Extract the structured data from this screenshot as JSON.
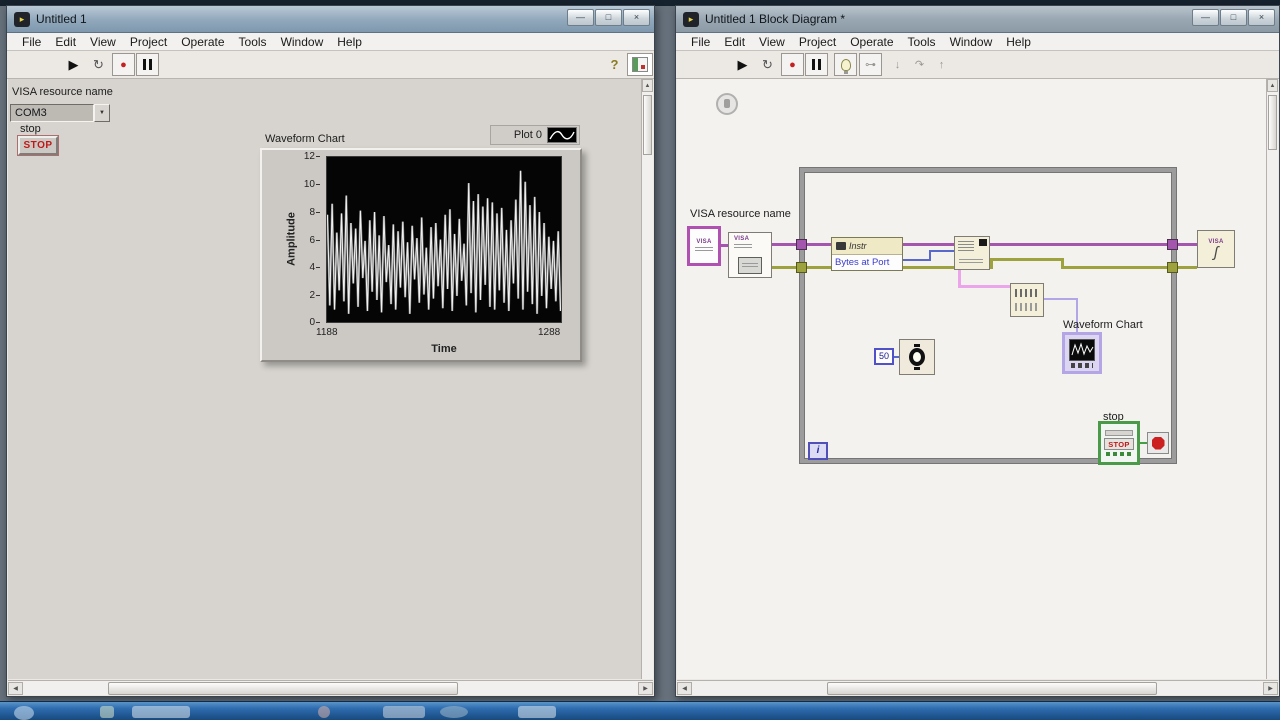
{
  "menus": [
    "File",
    "Edit",
    "View",
    "Project",
    "Operate",
    "Tools",
    "Window",
    "Help"
  ],
  "glyphs": {
    "lv_logo": "▸",
    "run": "▶",
    "run_continuous": "↻",
    "abort": "●",
    "help": "?",
    "dropdown": "▼",
    "scroll_left": "◀",
    "scroll_right": "▶",
    "scroll_up": "▲",
    "minimize": "—",
    "maximize": "□",
    "close": "×",
    "step_a": "↓",
    "step_b": "↷",
    "step_c": "↑",
    "retain": "⊶",
    "visa_close_glyph": "ʃ"
  },
  "front_panel": {
    "window_title": "Untitled 1",
    "visa_label": "VISA resource name",
    "visa_value": "COM3",
    "stop_label": "stop",
    "stop_button_text": "STOP",
    "chart": {
      "title": "Waveform Chart",
      "legend_label": "Plot 0",
      "y_axis_label": "Amplitude",
      "x_axis_label": "Time",
      "y_ticks": [
        "12",
        "10",
        "8",
        "6",
        "4",
        "2",
        "0"
      ],
      "x_tick_left": "1188",
      "x_tick_right": "1288"
    }
  },
  "block_diagram": {
    "window_title": "Untitled 1 Block Diagram *",
    "visa_constant_label": "VISA resource name",
    "visa_constant_text": "VISA",
    "visa_config_text": "VISA",
    "property_node_header": "Instr",
    "property_node_item": "Bytes at Port",
    "wait_constant": "50",
    "chart_terminal_label": "Waveform Chart",
    "stop_label": "stop",
    "stop_button_text": "STOP",
    "iteration_text": "i",
    "visa_close_text": "VISA"
  },
  "colors": {
    "visa_wire": "#a455ae",
    "error_wire": "#9da23e",
    "string_wire": "#eba6eb",
    "numeric_wire": "#b2a6e6",
    "integer_wire": "#5868cc",
    "boolean_wire": "#44a044",
    "stop_red": "#c01818",
    "boolean_green": "#4a9a4a",
    "plot_background": "#000000",
    "trace": "#ffffff"
  },
  "chart_data": {
    "type": "line",
    "title": "Waveform Chart",
    "xlabel": "Time",
    "ylabel": "Amplitude",
    "xlim": [
      1188,
      1288
    ],
    "ylim": [
      0,
      12
    ],
    "y_ticks": [
      0,
      2,
      4,
      6,
      8,
      10,
      12
    ],
    "grid": false,
    "legend_position": "top-right",
    "plot_background": "#000000",
    "series": [
      {
        "name": "Plot 0",
        "color": "#ffffff",
        "values": [
          7.8,
          1.2,
          8.6,
          0.9,
          6.5,
          2.3,
          7.9,
          1.5,
          9.2,
          0.6,
          7.2,
          2.8,
          6.8,
          1.1,
          8.1,
          3.2,
          5.9,
          0.8,
          7.4,
          2.2,
          8.0,
          1.6,
          6.3,
          0.7,
          7.7,
          2.9,
          5.6,
          1.3,
          7.1,
          0.9,
          6.6,
          2.5,
          7.3,
          1.8,
          5.8,
          0.6,
          7.0,
          3.1,
          6.1,
          1.4,
          7.6,
          2.0,
          5.4,
          0.9,
          6.9,
          1.7,
          7.2,
          2.6,
          6.0,
          1.0,
          7.8,
          2.4,
          8.2,
          0.8,
          6.4,
          1.9,
          7.5,
          3.0,
          5.7,
          1.2,
          10.1,
          2.1,
          8.8,
          0.7,
          9.3,
          1.6,
          8.4,
          2.7,
          9.0,
          1.1,
          8.7,
          0.9,
          7.9,
          2.3,
          8.3,
          1.4,
          6.7,
          0.8,
          7.4,
          2.8,
          8.9,
          1.7,
          11.0,
          0.9,
          10.2,
          2.2,
          8.5,
          1.3,
          9.1,
          0.6,
          8.0,
          1.9,
          7.2,
          1.0,
          6.2,
          2.4,
          5.9,
          1.5,
          6.6,
          0.8
        ]
      }
    ]
  }
}
